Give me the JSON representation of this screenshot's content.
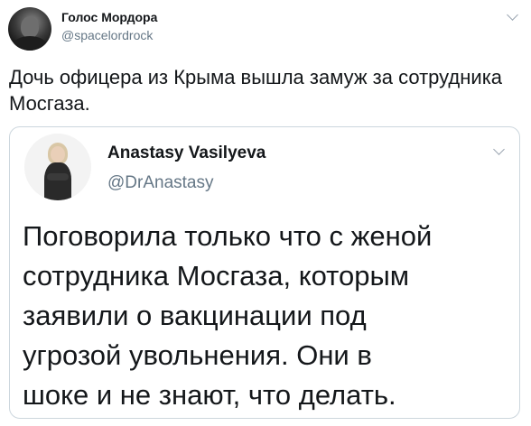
{
  "tweet": {
    "author_name": "Голос Мордора",
    "author_handle": "@spacelordrock",
    "text": "Дочь офицера из Крыма вышла замуж за сотрудника Мосгаза.",
    "menu_icon": "chevron-down-icon"
  },
  "quoted_tweet": {
    "author_name": "Anastasy Vasilyeva",
    "author_handle": "@DrAnastasy",
    "text": "Поговорила только что с женой\nсотрудника Мосгаза, которым\nзаявили о вакцинации под\nугрозой увольнения. Они в\nшоке  и не знают, что делать.",
    "menu_icon": "chevron-down-icon"
  },
  "colors": {
    "text_primary": "#14171a",
    "text_secondary": "#657786",
    "border": "#ccd6dd"
  }
}
